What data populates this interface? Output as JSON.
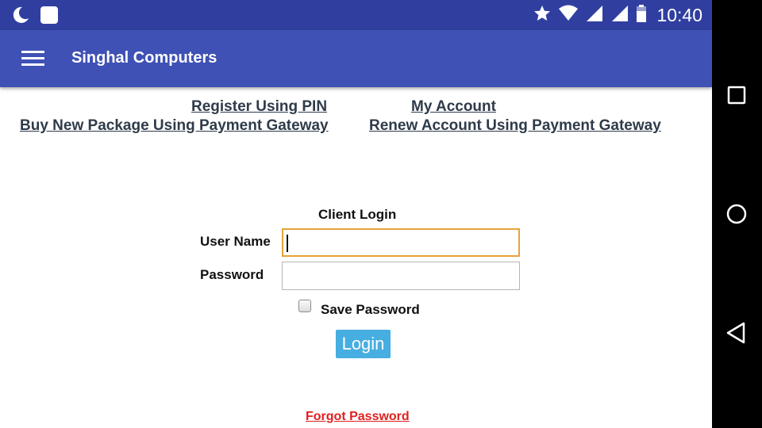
{
  "status_bar": {
    "time": "10:40",
    "icons": [
      "moon-icon",
      "notification-square-icon",
      "star-icon",
      "wifi-icon",
      "cell-signal-icon",
      "cell-signal-2-icon",
      "battery-icon"
    ]
  },
  "app_bar": {
    "title": "Singhal Computers",
    "menu_icon": "hamburger-menu-icon"
  },
  "links": {
    "register_pin": "Register Using PIN",
    "my_account": "My Account",
    "buy_package": "Buy New Package Using Payment Gateway",
    "renew_account": "Renew Account Using Payment Gateway"
  },
  "login_form": {
    "heading": "Client Login",
    "username_label": "User Name",
    "username_value": "",
    "password_label": "Password",
    "password_value": "",
    "save_password_label": "Save Password",
    "save_password_checked": false,
    "login_button": "Login",
    "forgot_password": "Forgot Password"
  },
  "nav_bar": {
    "buttons": [
      "recents-square-icon",
      "home-circle-icon",
      "back-triangle-icon"
    ]
  },
  "colors": {
    "status_bar": "#303f9f",
    "app_bar": "#3f51b5",
    "link": "#2f3b4a",
    "login_button": "#46aee0",
    "forgot_link": "#e02020",
    "focus_border": "#e6a23a"
  }
}
